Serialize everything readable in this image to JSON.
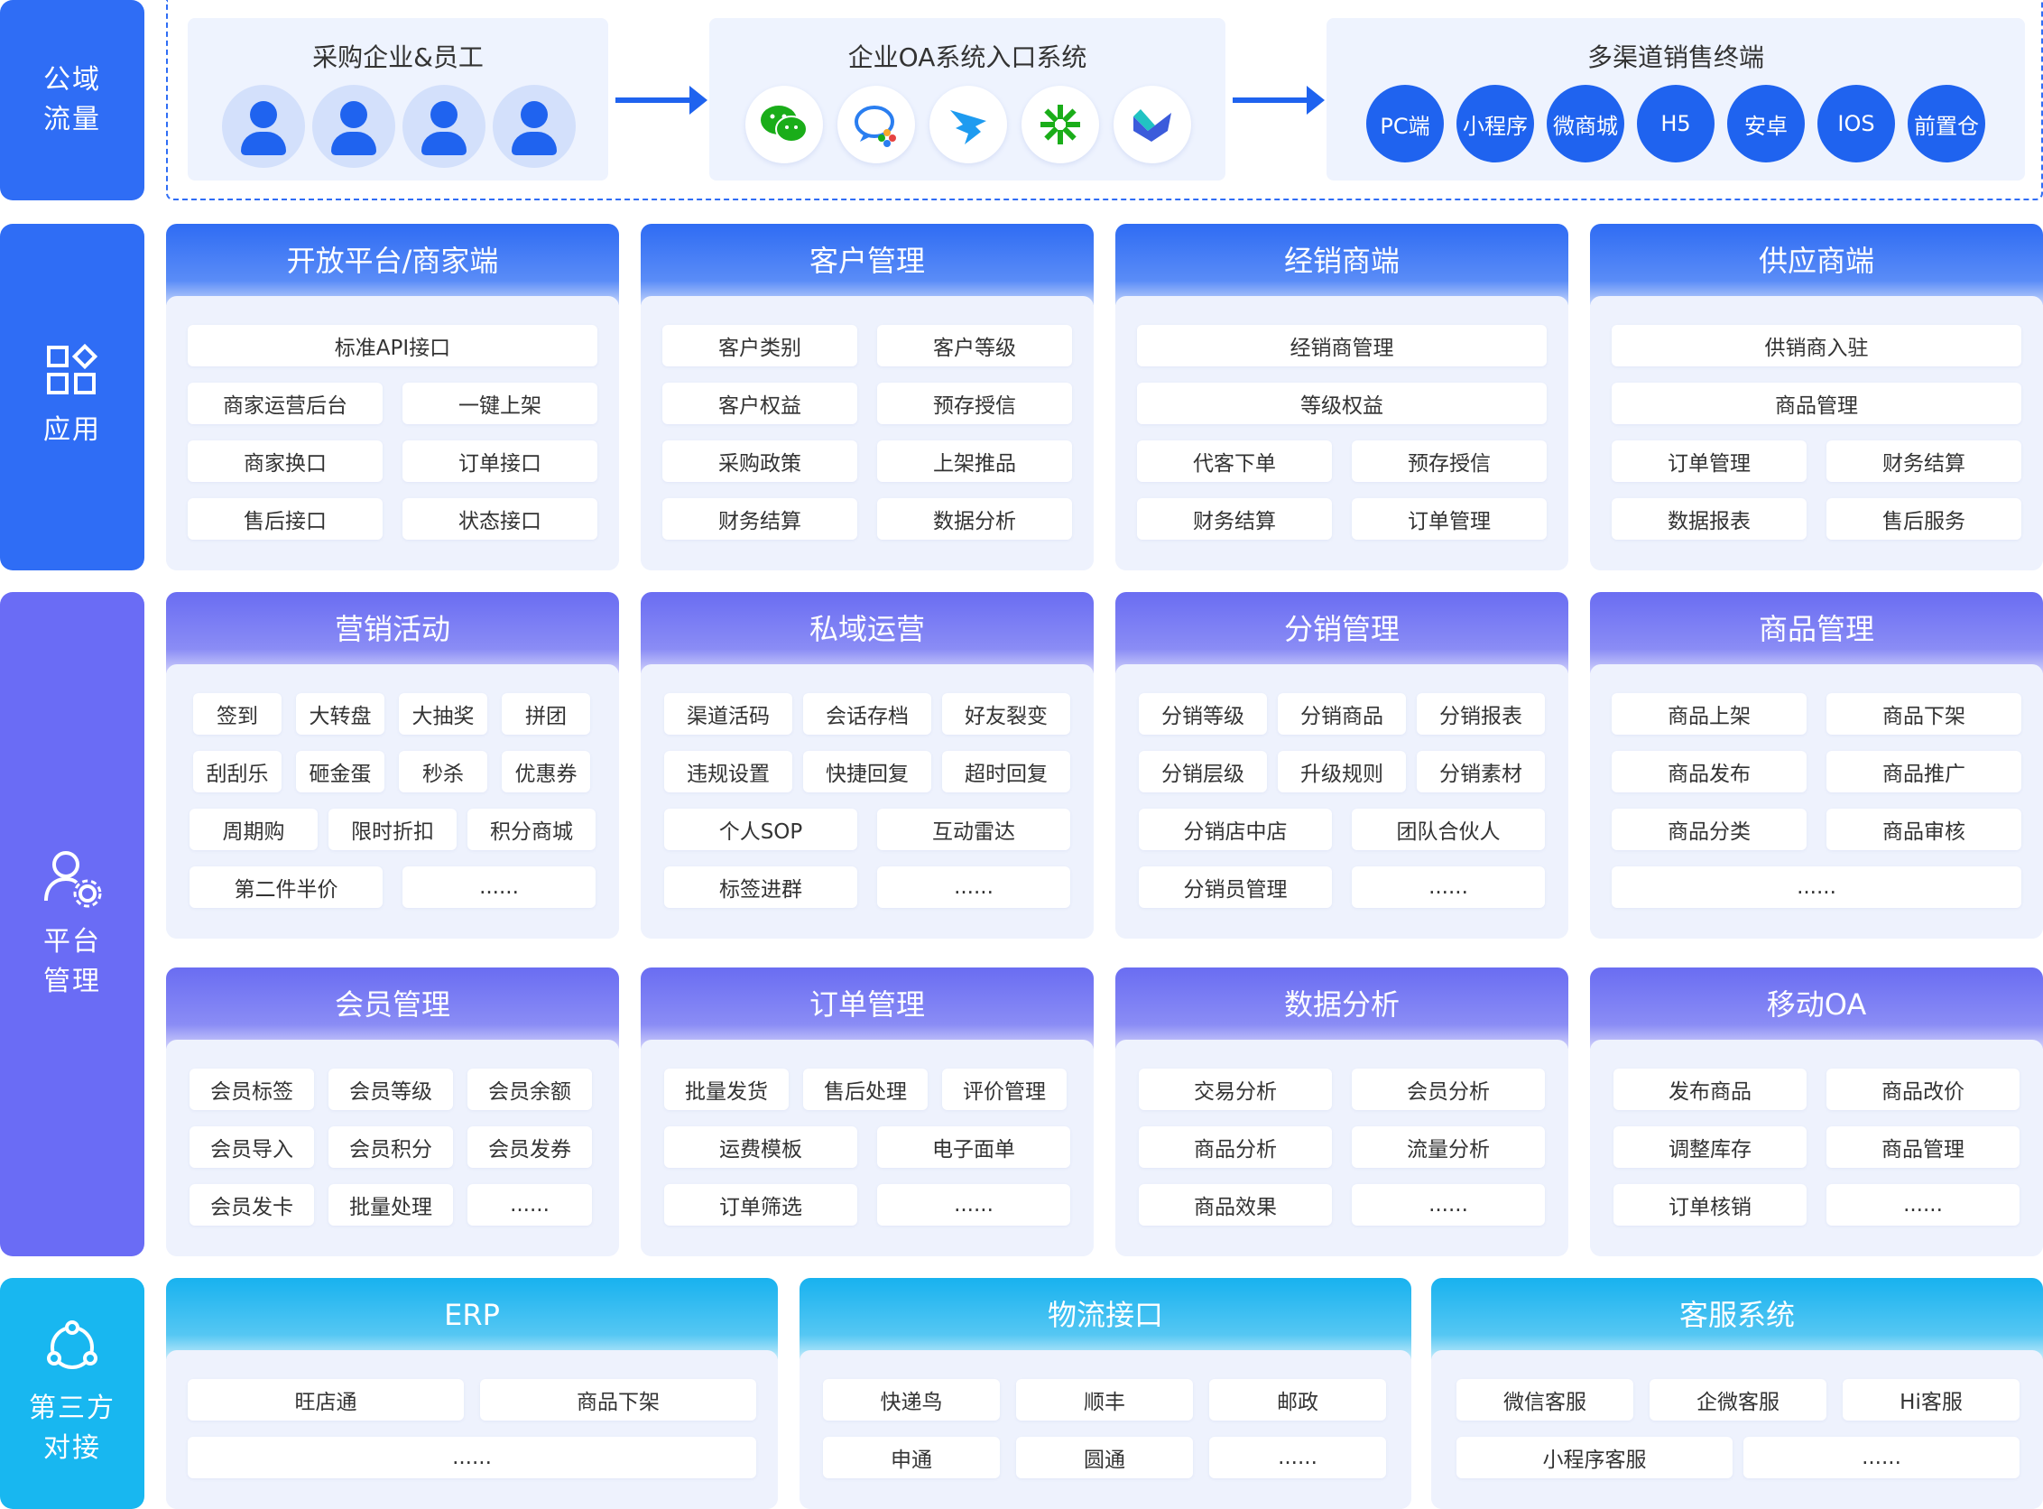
{
  "left_labels": {
    "traffic": [
      "公域",
      "流量"
    ],
    "apps": "应用",
    "platform": [
      "平台",
      "管理"
    ],
    "third": [
      "第三方",
      "对接"
    ]
  },
  "flow": {
    "buyers": {
      "title": "采购企业&员工"
    },
    "oa": {
      "title": "企业OA系统入口系统",
      "apps": [
        "wechat-icon",
        "wecom-icon",
        "dingtalk-icon",
        "feishu-icon",
        "lark-icon"
      ]
    },
    "channels": {
      "title": "多渠道销售终端",
      "items": [
        "PC端",
        "小程序",
        "微商城",
        "H5",
        "安卓",
        "IOS",
        "前置仓"
      ]
    }
  },
  "modules": {
    "open_platform": {
      "title": "开放平台/商家端",
      "items": [
        "标准API接口",
        "商家运营后台",
        "一键上架",
        "商家换口",
        "订单接口",
        "售后接口",
        "状态接口"
      ]
    },
    "customer": {
      "title": "客户管理",
      "items": [
        "客户类别",
        "客户等级",
        "客户权益",
        "预存授信",
        "采购政策",
        "上架推品",
        "财务结算",
        "数据分析"
      ]
    },
    "dealer": {
      "title": "经销商端",
      "items": [
        "经销商管理",
        "等级权益",
        "代客下单",
        "预存授信",
        "财务结算",
        "订单管理"
      ]
    },
    "supplier": {
      "title": "供应商端",
      "items": [
        "供销商入驻",
        "商品管理",
        "订单管理",
        "财务结算",
        "数据报表",
        "售后服务"
      ]
    },
    "marketing": {
      "title": "营销活动",
      "items": [
        "签到",
        "大转盘",
        "大抽奖",
        "拼团",
        "刮刮乐",
        "砸金蛋",
        "秒杀",
        "优惠券",
        "周期购",
        "限时折扣",
        "积分商城",
        "第二件半价",
        "......"
      ]
    },
    "private": {
      "title": "私域运营",
      "items": [
        "渠道活码",
        "会话存档",
        "好友裂变",
        "违规设置",
        "快捷回复",
        "超时回复",
        "个人SOP",
        "互动雷达",
        "标签进群",
        "......"
      ]
    },
    "distribution": {
      "title": "分销管理",
      "items": [
        "分销等级",
        "分销商品",
        "分销报表",
        "分销层级",
        "升级规则",
        "分销素材",
        "分销店中店",
        "团队合伙人",
        "分销员管理",
        "......"
      ]
    },
    "goods": {
      "title": "商品管理",
      "items": [
        "商品上架",
        "商品下架",
        "商品发布",
        "商品推广",
        "商品分类",
        "商品审核",
        "......"
      ]
    },
    "member": {
      "title": "会员管理",
      "items": [
        "会员标签",
        "会员等级",
        "会员余额",
        "会员导入",
        "会员积分",
        "会员发券",
        "会员发卡",
        "批量处理",
        "......"
      ]
    },
    "order": {
      "title": "订单管理",
      "items": [
        "批量发货",
        "售后处理",
        "评价管理",
        "运费模板",
        "电子面单",
        "订单筛选",
        "......"
      ]
    },
    "data": {
      "title": "数据分析",
      "items": [
        "交易分析",
        "会员分析",
        "商品分析",
        "流量分析",
        "商品效果",
        "......"
      ]
    },
    "mobile_oa": {
      "title": "移动OA",
      "items": [
        "发布商品",
        "商品改价",
        "调整库存",
        "商品管理",
        "订单核销",
        "......"
      ]
    },
    "erp": {
      "title": "ERP",
      "items": [
        "旺店通",
        "商品下架",
        "......"
      ]
    },
    "logistics": {
      "title": "物流接口",
      "items": [
        "快递鸟",
        "顺丰",
        "邮政",
        "申通",
        "圆通",
        "......"
      ]
    },
    "service": {
      "title": "客服系统",
      "items": [
        "微信客服",
        "企微客服",
        "Hi客服",
        "小程序客服",
        "......"
      ]
    }
  }
}
